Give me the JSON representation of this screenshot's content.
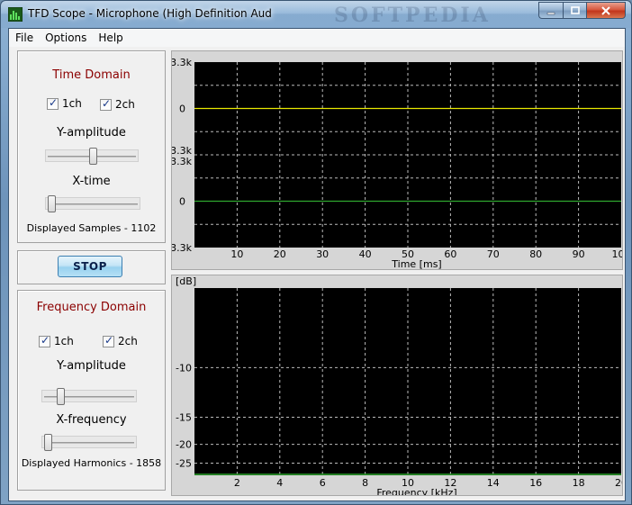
{
  "window": {
    "title": "TFD Scope - Microphone (High Definition Aud",
    "watermark": "SOFTPEDIA"
  },
  "menu": [
    "File",
    "Options",
    "Help"
  ],
  "time_domain": {
    "title": "Time Domain",
    "ch1_label": "1ch",
    "ch2_label": "2ch",
    "y_amp_label": "Y-amplitude",
    "y_amp_level": 0.5,
    "x_label": "X-time",
    "x_level": 0.0,
    "info": "Displayed Samples - 1102"
  },
  "stop_label": "STOP",
  "freq_domain": {
    "title": "Frequency Domain",
    "ch1_label": "1ch",
    "ch2_label": "2ch",
    "y_amp_label": "Y-amplitude",
    "y_amp_level": 0.15,
    "x_label": "X-frequency",
    "x_level": 0.0,
    "info": "Displayed Harmonics - 1858"
  },
  "chart_data": [
    {
      "type": "line",
      "series": [
        {
          "name": "1ch",
          "color": "#e8e800",
          "y_value": 0,
          "ylim": [
            -3.3,
            3.3
          ]
        },
        {
          "name": "2ch",
          "color": "#2fa82f",
          "y_value": 0,
          "ylim": [
            -3.3,
            3.3
          ]
        }
      ],
      "y_ticks_top": [
        "3.3k",
        "0",
        "-3.3k"
      ],
      "y_ticks_bottom": [
        "3.3k",
        "0",
        "-3.3k"
      ],
      "x_ticks": [
        "10",
        "20",
        "30",
        "40",
        "50",
        "60",
        "70",
        "80",
        "90",
        "100"
      ],
      "xlim": [
        0,
        100
      ],
      "xlabel": "Time [ms]",
      "grid": true,
      "background": "#000000"
    },
    {
      "type": "line",
      "series": [
        {
          "name": "spectrum",
          "color": "#2fa82f",
          "y_value": -30
        }
      ],
      "y_unit": "[dB]",
      "y_ticks": [
        "-10",
        "-15",
        "-20",
        "-25"
      ],
      "x_ticks": [
        "2",
        "4",
        "6",
        "8",
        "10",
        "12",
        "14",
        "16",
        "18",
        "20"
      ],
      "xlim": [
        0,
        20
      ],
      "xlabel": "Frequency [kHz]",
      "grid": true,
      "background": "#000000"
    }
  ]
}
